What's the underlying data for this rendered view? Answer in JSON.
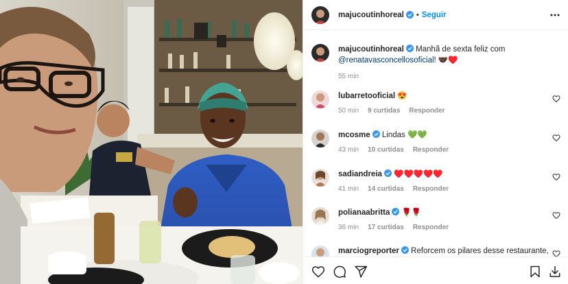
{
  "post": {
    "author": "majucoutinhoreal",
    "follow_label": "Seguir",
    "separator": "•",
    "caption_prefix": "Manhã de sexta feliz com",
    "caption_mention": "@renatavasconcellosoficial",
    "caption_suffix": "! 🤝🏿♥️",
    "time": "55 min"
  },
  "comments": [
    {
      "user": "lubarretooficial",
      "verified": false,
      "text": "😍",
      "time": "50 min",
      "likes": "9 curtidas",
      "reply": "Responder",
      "avatar_color": "#c4526a"
    },
    {
      "user": "mcosme",
      "verified": true,
      "text": "Lindas 💚💚",
      "time": "43 min",
      "likes": "10 curtidas",
      "reply": "Responder",
      "avatar_color": "#5a4a3c"
    },
    {
      "user": "sadiandreia",
      "verified": true,
      "text": "♥️♥️♥️♥️♥️",
      "time": "41 min",
      "likes": "14 curtidas",
      "reply": "Responder",
      "avatar_color": "#b07a5a"
    },
    {
      "user": "polianaabritta",
      "verified": true,
      "text": "🌹🌹",
      "time": "36 min",
      "likes": "17 curtidas",
      "reply": "Responder",
      "avatar_color": "#9a7552"
    },
    {
      "user": "marciogreporter",
      "verified": true,
      "text": "Reforcem os pilares desse restaurante,",
      "time": "",
      "likes": "",
      "reply": "",
      "avatar_color": "#8aa0b8"
    }
  ],
  "icons": {
    "more": "more-options-icon",
    "like": "heart-icon",
    "comment": "comment-icon",
    "share": "share-icon",
    "save": "bookmark-icon",
    "download": "download-icon",
    "verified": "verified-badge-icon"
  },
  "colors": {
    "accent": "#0095f6",
    "verified": "#3897f0",
    "mention": "#00376b",
    "secondary_text": "#8e8e8e"
  }
}
